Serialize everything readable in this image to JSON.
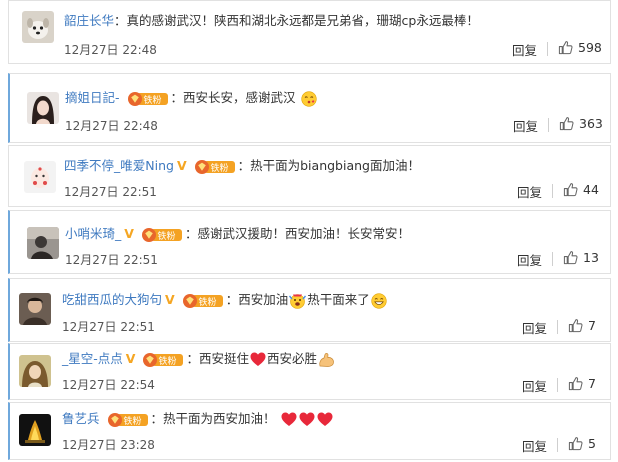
{
  "fan_badge_text": "铁粉",
  "reply_label": "回复",
  "comments": [
    {
      "username": "韶庄长华",
      "text": "真的感谢武汉！陕西和湖北永远都是兄弟省，珊瑚cp永远最棒！",
      "time": "12月27日 22:48",
      "likes": "598"
    },
    {
      "username": "摘姐日記-",
      "text": "西安长安，感谢武汉",
      "time": "12月27日 22:48",
      "likes": "363"
    },
    {
      "username": "四季不停_唯爱Ning",
      "text": "热干面为biangbiang面加油！",
      "time": "12月27日 22:51",
      "likes": "44"
    },
    {
      "username": "小哨米琦_",
      "text": "感谢武汉援助！西安加油！长安常安！",
      "time": "12月27日 22:51",
      "likes": "13"
    },
    {
      "username": "吃甜西瓜的大狗句",
      "text": "西安加油",
      "text2": "热干面来了",
      "time": "12月27日 22:51",
      "likes": "7"
    },
    {
      "username": "_星空-点点",
      "text": "西安挺住",
      "text2": "西安必胜",
      "time": "12月27日 22:54",
      "likes": "7"
    },
    {
      "username": "鲁艺兵",
      "text": "热干面为西安加油！",
      "time": "12月27日 23:28",
      "likes": "5"
    }
  ]
}
